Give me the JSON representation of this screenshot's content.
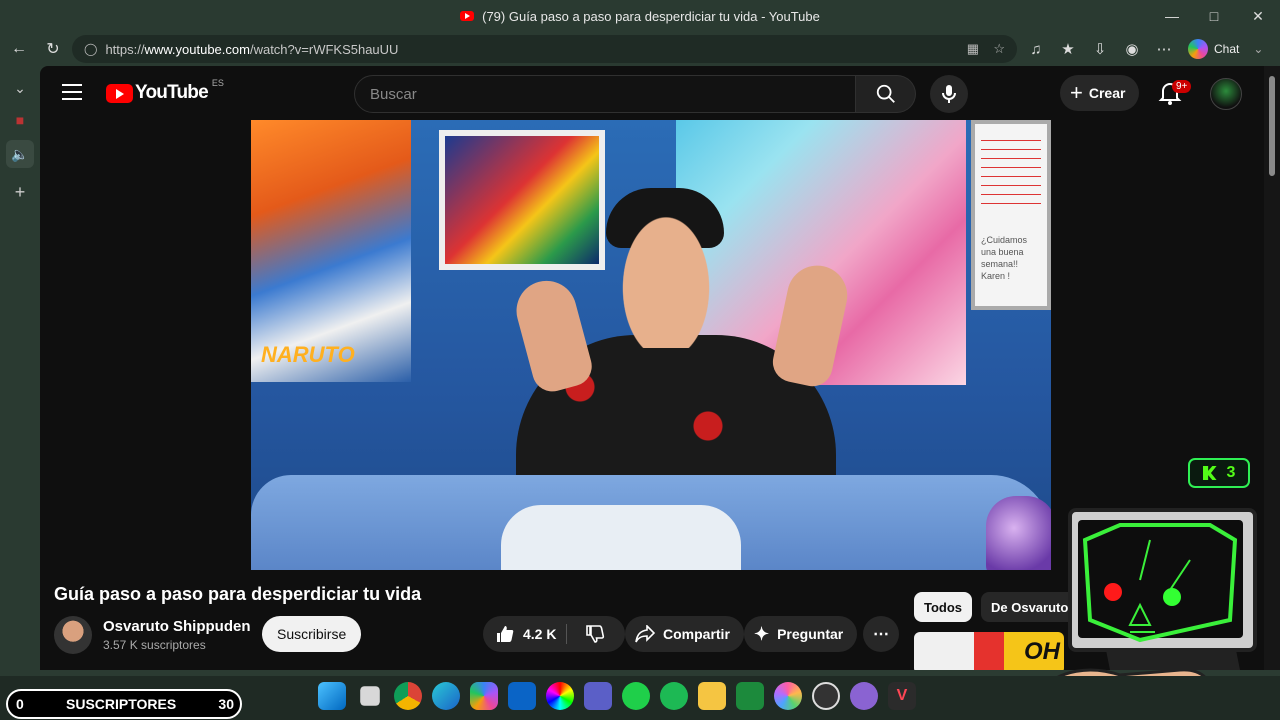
{
  "browser": {
    "title": "(79) Guía paso a paso para desperdiciar tu vida - YouTube",
    "url_prefix": "https://",
    "url_host": "www.youtube.com",
    "url_path": "/watch?v=rWFKS5hauUU",
    "chat_label": "Chat"
  },
  "youtube": {
    "logo_text": "YouTube",
    "region": "ES",
    "search_placeholder": "Buscar",
    "create_label": "Crear",
    "notifications_badge": "9+",
    "video": {
      "title": "Guía paso a paso para desperdiciar tu vida",
      "channel_name": "Osvaruto Shippuden",
      "subscribers": "3.57 K suscriptores",
      "subscribe_label": "Suscribirse",
      "likes": "4.2 K",
      "share_label": "Compartir",
      "ask_label": "Preguntar"
    },
    "chips": [
      "Todos",
      "De Osvaruto"
    ],
    "scene_text": {
      "naruto": "NARUTO",
      "whiteboard_note": [
        "¿Cuidamos",
        "una buena",
        "semana!!",
        "Karen !"
      ],
      "thumb_oh": "OH"
    }
  },
  "overlay": {
    "kick_count": "3",
    "counter": {
      "current": "0",
      "label": "SUSCRIPTORES",
      "goal": "30"
    }
  },
  "colors": {
    "brand_red": "#ff0000",
    "kick_green": "#53fc18",
    "page_bg": "#0f0f0f"
  }
}
